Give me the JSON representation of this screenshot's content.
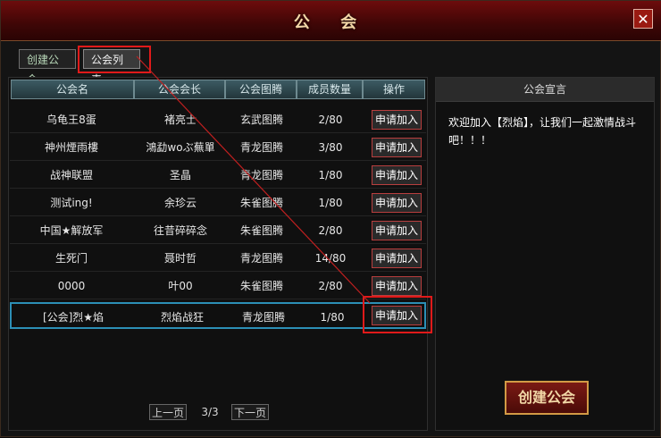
{
  "window": {
    "title": "公 会",
    "close_label": "✕"
  },
  "tabs": [
    {
      "label": "创建公会"
    },
    {
      "label": "公会列表"
    }
  ],
  "list": {
    "headers": [
      "公会名",
      "公会会长",
      "公会图腾",
      "成员数量",
      "操作"
    ],
    "rows": [
      {
        "name": "乌龟王8蛋",
        "leader": "褚亮士",
        "totem": "玄武图腾",
        "members": "2/80",
        "action": "申请加入"
      },
      {
        "name": "神州煙雨樓",
        "leader": "鴻勐woぶ蕪單",
        "totem": "青龙图腾",
        "members": "3/80",
        "action": "申请加入"
      },
      {
        "name": "战神联盟",
        "leader": "圣晶",
        "totem": "青龙图腾",
        "members": "1/80",
        "action": "申请加入"
      },
      {
        "name": "测试ing!",
        "leader": "余珍云",
        "totem": "朱雀图腾",
        "members": "1/80",
        "action": "申请加入"
      },
      {
        "name": "中国★解放军",
        "leader": "往昔碎碎念",
        "totem": "朱雀图腾",
        "members": "2/80",
        "action": "申请加入"
      },
      {
        "name": "生死门",
        "leader": "聂时哲",
        "totem": "青龙图腾",
        "members": "14/80",
        "action": "申请加入"
      },
      {
        "name": "0000",
        "leader": "叶00",
        "totem": "朱雀图腾",
        "members": "2/80",
        "action": "申请加入"
      },
      {
        "name": "[公会]烈★焰",
        "leader": "烈焰战狂",
        "totem": "青龙图腾",
        "members": "1/80",
        "action": "申请加入"
      }
    ]
  },
  "pager": {
    "prev_label": "上一页",
    "page": "3/3",
    "next_label": "下一页"
  },
  "declaration": {
    "title": "公会宣言",
    "text": "欢迎加入【烈焰】，让我们一起激情战斗吧！！！"
  },
  "create_button_label": "创建公会"
}
